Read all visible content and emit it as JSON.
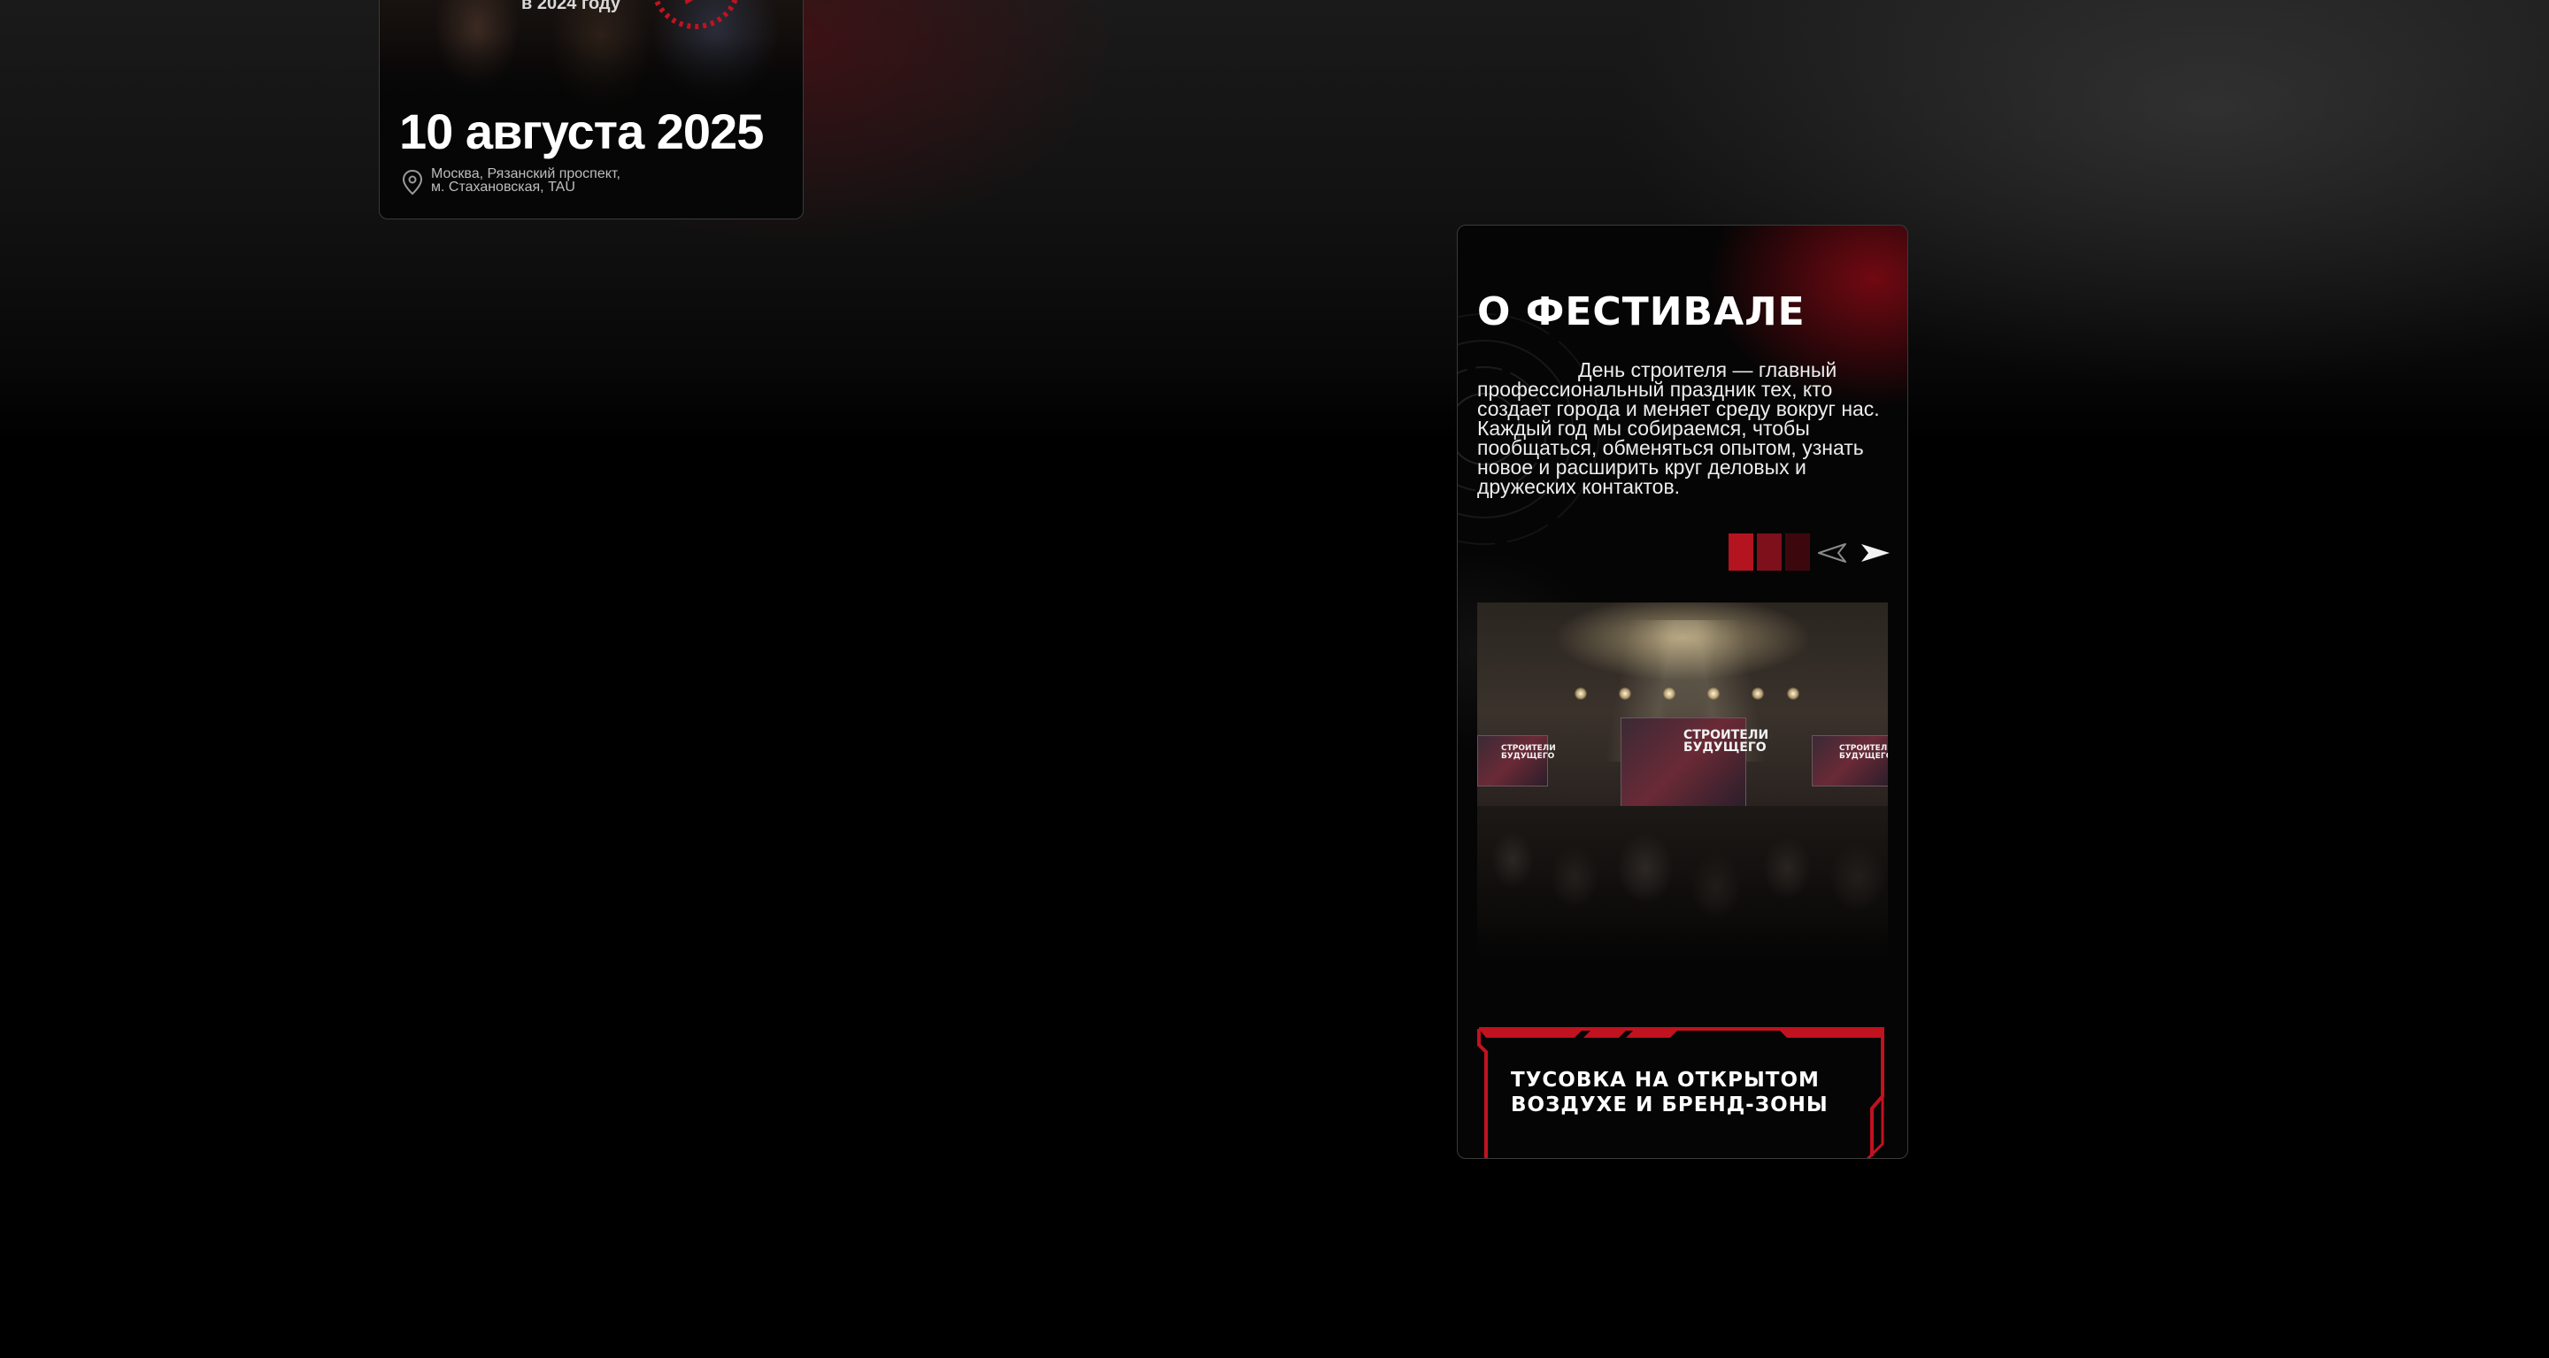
{
  "date_card": {
    "year_caption": "в 2024 году",
    "date": "10 августа 2025",
    "address_line1": "Москва, Рязанский проспект,",
    "address_line2": "м. Стахановская, TAU"
  },
  "festival_card": {
    "title": "О ФЕСТИВАЛЕ",
    "description": "День строителя — главный профессиональный праздник тех, кто создает города и меняет среду вокруг нас. Каждый год мы собираемся, чтобы пообщаться, обменяться опытом, узнать новое и расширить круг деловых и дружеских контактов.",
    "slider": {
      "slide_count": 3,
      "active_slide": 1
    },
    "photo": {
      "screen_text": "СТРОИТЕЛИ БУДУЩЕГО"
    },
    "feature_label": "ТУСОВКА НА ОТКРЫТОМ ВОЗДУХЕ И БРЕНД-ЗОНЫ"
  },
  "colors": {
    "accent_red": "#b31420",
    "background": "#000000",
    "card_border": "#3a3a3a"
  }
}
